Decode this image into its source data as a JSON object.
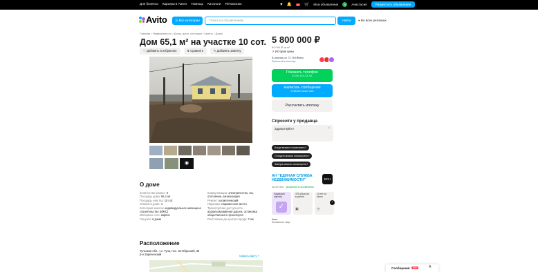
{
  "topbar": {
    "left": [
      "Для бизнеса",
      "Карьера в Авито",
      "Помощь",
      "Каталоги",
      "#яПомогаю"
    ],
    "icons": [
      "heart-icon",
      "bell-icon",
      "cart-icon"
    ],
    "notif_count": "1",
    "my_ads": "Мои объявления",
    "avatar_letter": "А",
    "user": "Анастасия",
    "post_ad": "Разместить объявление"
  },
  "header": {
    "logo": "Avito",
    "all_categories": "Все категории",
    "search_placeholder": "Поиск по объявлениям",
    "find": "Найти",
    "region": "Во всех регионах"
  },
  "listing": {
    "breadcrumbs": "Главная › Недвижимость › Дома, дачи, коттеджи › Купить › Дома",
    "title": "Дом 65,1 м² на участке 10 сот.",
    "actions": [
      "Добавить в избранное",
      "Сравнить",
      "Добавить заметку"
    ]
  },
  "about": {
    "heading": "О доме",
    "col1": [
      {
        "k": "Количество комнат:",
        "v": "3"
      },
      {
        "k": "Площадь дома:",
        "v": "65.1 м²"
      },
      {
        "k": "Площадь участка:",
        "v": "10 сот."
      },
      {
        "k": "Этажей в доме:",
        "v": "1"
      },
      {
        "k": "Категория земель:",
        "v": "индивидуальное жилищное строительство (ИЖС)"
      },
      {
        "k": "Материал стен:",
        "v": "кирпич"
      },
      {
        "k": "Санузел:",
        "v": "в доме"
      }
    ],
    "col2": [
      {
        "k": "Коммуникации:",
        "v": "электричество, газ, отопление, канализация"
      },
      {
        "k": "Ремонт:",
        "v": "косметический"
      },
      {
        "k": "Парковка:",
        "v": "парковочное место"
      },
      {
        "k": "Транспортная доступность:",
        "v": "асфальтированная дорога, остановка общественного транспорта"
      },
      {
        "k": "Расстояние до центра города:",
        "v": "7 км"
      }
    ]
  },
  "location": {
    "heading": "Расположение",
    "address": "Тульская обл., г.о. Тула, пос. Октябрьский, 38",
    "district": "р-н Зареченский",
    "hide_map": "Скрыть карту"
  },
  "sidebar": {
    "price": "5 800 000 ₽",
    "price_per_m": "89 094 ₽ за м²",
    "history": "История цены",
    "payment_note": "В ипотеку от 73 749 ₽/мес.",
    "payment_link": "Рассчитать ипотеку",
    "show_phone": "Показать телефон",
    "phone_mask": "8 XXX XXX-XX-XX",
    "write_msg": "Написать сообщение",
    "msg_sub": "Отвечает около часа",
    "mortgage": "Рассчитать ипотеку",
    "ask_heading": "Спросите у продавца",
    "ask_placeholder": "Здравствуйте!",
    "quick": [
      "Когда можно посмотреть?",
      "Сегодня можно посмотреть?",
      "Завтра можно посмотреть?"
    ],
    "agency": "АН \"ЕДИНАЯ СЛУЖБА НЕДВИЖИМОСТИ\"",
    "agency_type": "Агентство",
    "agency_status": "· Документы проверены",
    "agency_logo": "ЕСН",
    "cards": [
      "Надёжный партнёр",
      "375 объектов в работе",
      "14 лет на Авито"
    ],
    "contact_name": "Анна",
    "contact_role": "Контактное лицо"
  },
  "messages": {
    "label": "Сообщения",
    "count": "99+"
  },
  "colors": {
    "accent": "#00aaff",
    "green": "#02d15c",
    "dark": "#000000"
  }
}
